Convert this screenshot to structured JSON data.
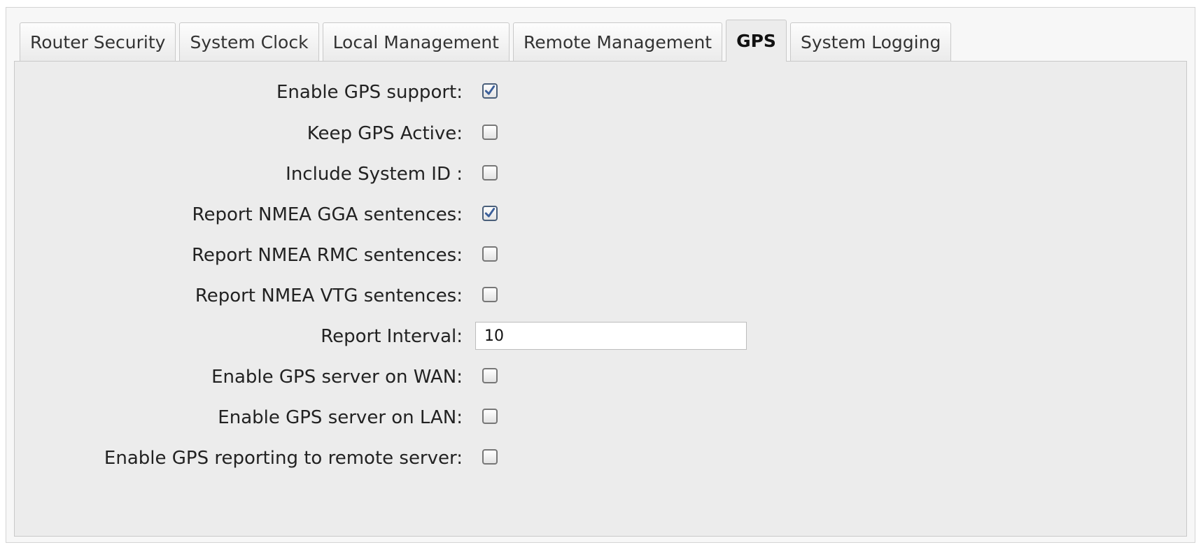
{
  "tabs": [
    {
      "label": "Router Security",
      "active": false
    },
    {
      "label": "System Clock",
      "active": false
    },
    {
      "label": "Local Management",
      "active": false
    },
    {
      "label": "Remote Management",
      "active": false
    },
    {
      "label": "GPS",
      "active": true
    },
    {
      "label": "System Logging",
      "active": false
    }
  ],
  "gps_settings": {
    "enable_gps_support": {
      "label": "Enable GPS support:",
      "checked": true
    },
    "keep_gps_active": {
      "label": "Keep GPS Active:",
      "checked": false
    },
    "include_system_id": {
      "label": "Include System ID :",
      "checked": false
    },
    "report_nmea_gga": {
      "label": "Report NMEA GGA sentences:",
      "checked": true
    },
    "report_nmea_rmc": {
      "label": "Report NMEA RMC sentences:",
      "checked": false
    },
    "report_nmea_vtg": {
      "label": "Report NMEA VTG sentences:",
      "checked": false
    },
    "report_interval": {
      "label": "Report Interval:",
      "value": "10"
    },
    "gps_server_wan": {
      "label": "Enable GPS server on WAN:",
      "checked": false
    },
    "gps_server_lan": {
      "label": "Enable GPS server on LAN:",
      "checked": false
    },
    "gps_reporting_remote": {
      "label": "Enable GPS reporting to remote server:",
      "checked": false
    }
  },
  "colors": {
    "panel_bg": "#ececec",
    "check_mark": "#3b5f9a"
  }
}
